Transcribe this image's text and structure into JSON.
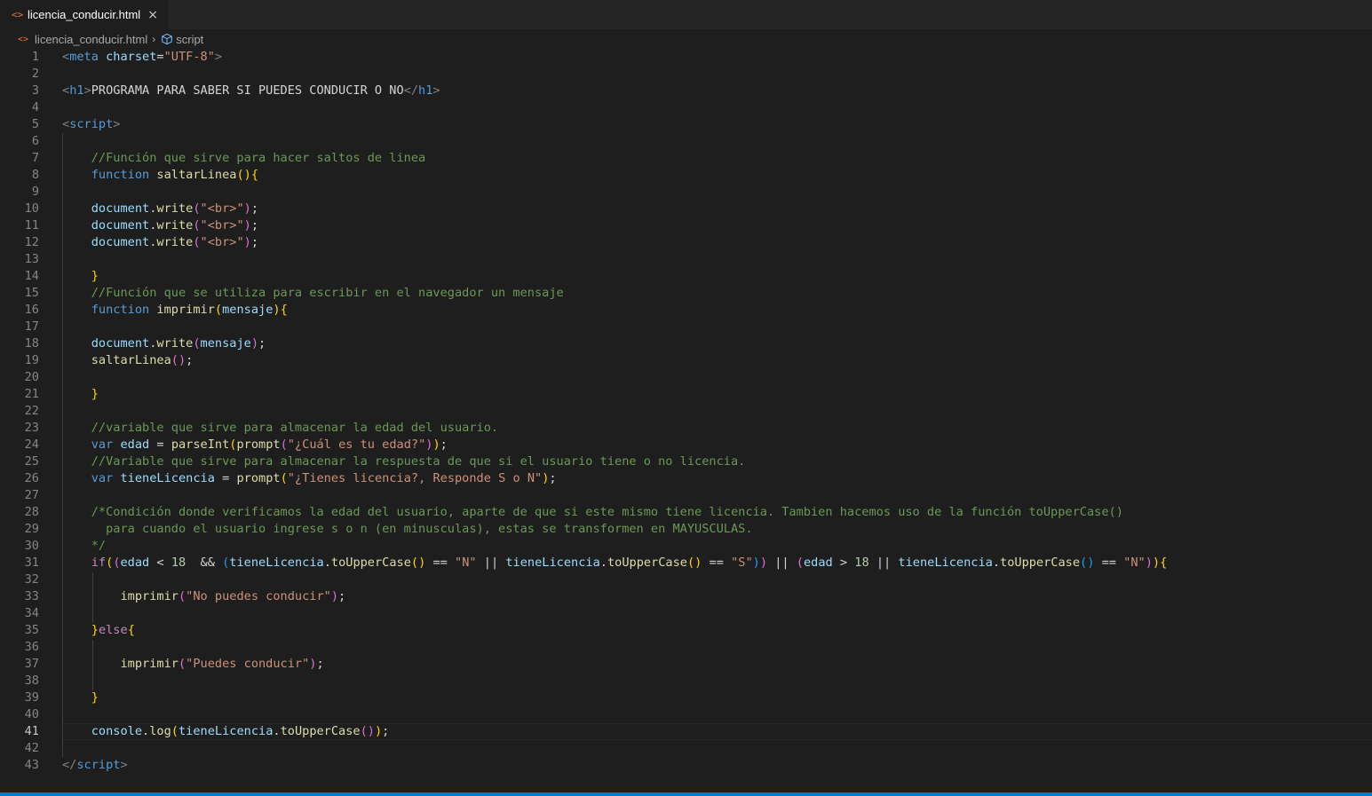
{
  "tab": {
    "icon": "html-file-icon",
    "label": "licencia_conducir.html",
    "close": "×"
  },
  "breadcrumb": {
    "file": "licencia_conducir.html",
    "symbol": "script"
  },
  "editor": {
    "active_line": 41,
    "lines": [
      {
        "n": 1,
        "tokens": [
          [
            "tag",
            "<"
          ],
          [
            "tagname",
            "meta"
          ],
          [
            "txt",
            " "
          ],
          [
            "attr",
            "charset"
          ],
          [
            "txt",
            "="
          ],
          [
            "str",
            "\"UTF-8\""
          ],
          [
            "tag",
            ">"
          ]
        ]
      },
      {
        "n": 2,
        "tokens": []
      },
      {
        "n": 3,
        "tokens": [
          [
            "tag",
            "<"
          ],
          [
            "tagname",
            "h1"
          ],
          [
            "tag",
            ">"
          ],
          [
            "txt",
            "PROGRAMA PARA SABER SI PUEDES CONDUCIR O NO"
          ],
          [
            "tag",
            "</"
          ],
          [
            "tagname",
            "h1"
          ],
          [
            "tag",
            ">"
          ]
        ]
      },
      {
        "n": 4,
        "tokens": []
      },
      {
        "n": 5,
        "tokens": [
          [
            "tag",
            "<"
          ],
          [
            "tagname",
            "script"
          ],
          [
            "tag",
            ">"
          ]
        ]
      },
      {
        "n": 6,
        "tokens": []
      },
      {
        "n": 7,
        "tokens": [
          [
            "txt",
            "    "
          ],
          [
            "com",
            "//Función que sirve para hacer saltos de linea"
          ]
        ]
      },
      {
        "n": 8,
        "tokens": [
          [
            "txt",
            "    "
          ],
          [
            "kw",
            "function"
          ],
          [
            "txt",
            " "
          ],
          [
            "fn",
            "saltarLinea"
          ],
          [
            "b1",
            "(){"
          ]
        ]
      },
      {
        "n": 9,
        "tokens": []
      },
      {
        "n": 10,
        "tokens": [
          [
            "txt",
            "    "
          ],
          [
            "var",
            "document"
          ],
          [
            "txt",
            "."
          ],
          [
            "fn",
            "write"
          ],
          [
            "b2",
            "("
          ],
          [
            "str",
            "\"<br>\""
          ],
          [
            "b2",
            ")"
          ],
          [
            "txt",
            ";"
          ]
        ]
      },
      {
        "n": 11,
        "tokens": [
          [
            "txt",
            "    "
          ],
          [
            "var",
            "document"
          ],
          [
            "txt",
            "."
          ],
          [
            "fn",
            "write"
          ],
          [
            "b2",
            "("
          ],
          [
            "str",
            "\"<br>\""
          ],
          [
            "b2",
            ")"
          ],
          [
            "txt",
            ";"
          ]
        ]
      },
      {
        "n": 12,
        "tokens": [
          [
            "txt",
            "    "
          ],
          [
            "var",
            "document"
          ],
          [
            "txt",
            "."
          ],
          [
            "fn",
            "write"
          ],
          [
            "b2",
            "("
          ],
          [
            "str",
            "\"<br>\""
          ],
          [
            "b2",
            ")"
          ],
          [
            "txt",
            ";"
          ]
        ]
      },
      {
        "n": 13,
        "tokens": []
      },
      {
        "n": 14,
        "tokens": [
          [
            "txt",
            "    "
          ],
          [
            "b1",
            "}"
          ]
        ]
      },
      {
        "n": 15,
        "tokens": [
          [
            "txt",
            "    "
          ],
          [
            "com",
            "//Función que se utiliza para escribir en el navegador un mensaje"
          ]
        ]
      },
      {
        "n": 16,
        "tokens": [
          [
            "txt",
            "    "
          ],
          [
            "kw",
            "function"
          ],
          [
            "txt",
            " "
          ],
          [
            "fn",
            "imprimir"
          ],
          [
            "b1",
            "("
          ],
          [
            "var",
            "mensaje"
          ],
          [
            "b1",
            "){"
          ]
        ]
      },
      {
        "n": 17,
        "tokens": []
      },
      {
        "n": 18,
        "tokens": [
          [
            "txt",
            "    "
          ],
          [
            "var",
            "document"
          ],
          [
            "txt",
            "."
          ],
          [
            "fn",
            "write"
          ],
          [
            "b2",
            "("
          ],
          [
            "var",
            "mensaje"
          ],
          [
            "b2",
            ")"
          ],
          [
            "txt",
            ";"
          ]
        ]
      },
      {
        "n": 19,
        "tokens": [
          [
            "txt",
            "    "
          ],
          [
            "fn",
            "saltarLinea"
          ],
          [
            "b2",
            "()"
          ],
          [
            "txt",
            ";"
          ]
        ]
      },
      {
        "n": 20,
        "tokens": []
      },
      {
        "n": 21,
        "tokens": [
          [
            "txt",
            "    "
          ],
          [
            "b1",
            "}"
          ]
        ]
      },
      {
        "n": 22,
        "tokens": []
      },
      {
        "n": 23,
        "tokens": [
          [
            "txt",
            "    "
          ],
          [
            "com",
            "//variable que sirve para almacenar la edad del usuario."
          ]
        ]
      },
      {
        "n": 24,
        "tokens": [
          [
            "txt",
            "    "
          ],
          [
            "kw",
            "var"
          ],
          [
            "txt",
            " "
          ],
          [
            "var",
            "edad"
          ],
          [
            "txt",
            " = "
          ],
          [
            "fn",
            "parseInt"
          ],
          [
            "b1",
            "("
          ],
          [
            "fn",
            "prompt"
          ],
          [
            "b2",
            "("
          ],
          [
            "str",
            "\"¿Cuál es tu edad?\""
          ],
          [
            "b2",
            ")"
          ],
          [
            "b1",
            ")"
          ],
          [
            "txt",
            ";"
          ]
        ]
      },
      {
        "n": 25,
        "tokens": [
          [
            "txt",
            "    "
          ],
          [
            "com",
            "//Variable que sirve para almacenar la respuesta de que si el usuario tiene o no licencia."
          ]
        ]
      },
      {
        "n": 26,
        "tokens": [
          [
            "txt",
            "    "
          ],
          [
            "kw",
            "var"
          ],
          [
            "txt",
            " "
          ],
          [
            "var",
            "tieneLicencia"
          ],
          [
            "txt",
            " = "
          ],
          [
            "fn",
            "prompt"
          ],
          [
            "b1",
            "("
          ],
          [
            "str",
            "\"¿Tienes licencia?, Responde S o N\""
          ],
          [
            "b1",
            ")"
          ],
          [
            "txt",
            ";"
          ]
        ]
      },
      {
        "n": 27,
        "tokens": []
      },
      {
        "n": 28,
        "tokens": [
          [
            "txt",
            "    "
          ],
          [
            "com",
            "/*Condición donde verificamos la edad del usuario, aparte de que si este mismo tiene licencia. Tambien hacemos uso de la función toUpperCase()"
          ]
        ]
      },
      {
        "n": 29,
        "tokens": [
          [
            "txt",
            "    "
          ],
          [
            "com",
            "  para cuando el usuario ingrese s o n (en minusculas), estas se transformen en MAYUSCULAS."
          ]
        ]
      },
      {
        "n": 30,
        "tokens": [
          [
            "txt",
            "    "
          ],
          [
            "com",
            "*/"
          ]
        ]
      },
      {
        "n": 31,
        "tokens": [
          [
            "txt",
            "    "
          ],
          [
            "ctrl",
            "if"
          ],
          [
            "b1",
            "("
          ],
          [
            "b2",
            "("
          ],
          [
            "var",
            "edad"
          ],
          [
            "txt",
            " < "
          ],
          [
            "num",
            "18"
          ],
          [
            "txt",
            "  && "
          ],
          [
            "b3",
            "("
          ],
          [
            "var",
            "tieneLicencia"
          ],
          [
            "txt",
            "."
          ],
          [
            "fn",
            "toUpperCase"
          ],
          [
            "b1",
            "()"
          ],
          [
            "txt",
            " == "
          ],
          [
            "str",
            "\"N\""
          ],
          [
            "txt",
            " || "
          ],
          [
            "var",
            "tieneLicencia"
          ],
          [
            "txt",
            "."
          ],
          [
            "fn",
            "toUpperCase"
          ],
          [
            "b1",
            "()"
          ],
          [
            "txt",
            " == "
          ],
          [
            "str",
            "\"S\""
          ],
          [
            "b3",
            ")"
          ],
          [
            "b2",
            ")"
          ],
          [
            "txt",
            " || "
          ],
          [
            "b2",
            "("
          ],
          [
            "var",
            "edad"
          ],
          [
            "txt",
            " > "
          ],
          [
            "num",
            "18"
          ],
          [
            "txt",
            " || "
          ],
          [
            "var",
            "tieneLicencia"
          ],
          [
            "txt",
            "."
          ],
          [
            "fn",
            "toUpperCase"
          ],
          [
            "b3",
            "()"
          ],
          [
            "txt",
            " == "
          ],
          [
            "str",
            "\"N\""
          ],
          [
            "b2",
            ")"
          ],
          [
            "b1",
            "){"
          ]
        ]
      },
      {
        "n": 32,
        "tokens": []
      },
      {
        "n": 33,
        "tokens": [
          [
            "txt",
            "        "
          ],
          [
            "fn",
            "imprimir"
          ],
          [
            "b2",
            "("
          ],
          [
            "str",
            "\"No puedes conducir\""
          ],
          [
            "b2",
            ")"
          ],
          [
            "txt",
            ";"
          ]
        ]
      },
      {
        "n": 34,
        "tokens": []
      },
      {
        "n": 35,
        "tokens": [
          [
            "txt",
            "    "
          ],
          [
            "b1",
            "}"
          ],
          [
            "ctrl",
            "else"
          ],
          [
            "b1",
            "{"
          ]
        ]
      },
      {
        "n": 36,
        "tokens": []
      },
      {
        "n": 37,
        "tokens": [
          [
            "txt",
            "        "
          ],
          [
            "fn",
            "imprimir"
          ],
          [
            "b2",
            "("
          ],
          [
            "str",
            "\"Puedes conducir\""
          ],
          [
            "b2",
            ")"
          ],
          [
            "txt",
            ";"
          ]
        ]
      },
      {
        "n": 38,
        "tokens": []
      },
      {
        "n": 39,
        "tokens": [
          [
            "txt",
            "    "
          ],
          [
            "b1",
            "}"
          ]
        ]
      },
      {
        "n": 40,
        "tokens": []
      },
      {
        "n": 41,
        "tokens": [
          [
            "txt",
            "    "
          ],
          [
            "var",
            "console"
          ],
          [
            "txt",
            "."
          ],
          [
            "fn",
            "log"
          ],
          [
            "b1",
            "("
          ],
          [
            "var",
            "tieneLicencia"
          ],
          [
            "txt",
            "."
          ],
          [
            "fn",
            "toUpperCase"
          ],
          [
            "b2",
            "()"
          ],
          [
            "b1",
            ")"
          ],
          [
            "txt",
            ";"
          ]
        ]
      },
      {
        "n": 42,
        "tokens": []
      },
      {
        "n": 43,
        "tokens": [
          [
            "tag",
            "</"
          ],
          [
            "tagname",
            "script"
          ],
          [
            "tag",
            ">"
          ]
        ]
      }
    ]
  }
}
